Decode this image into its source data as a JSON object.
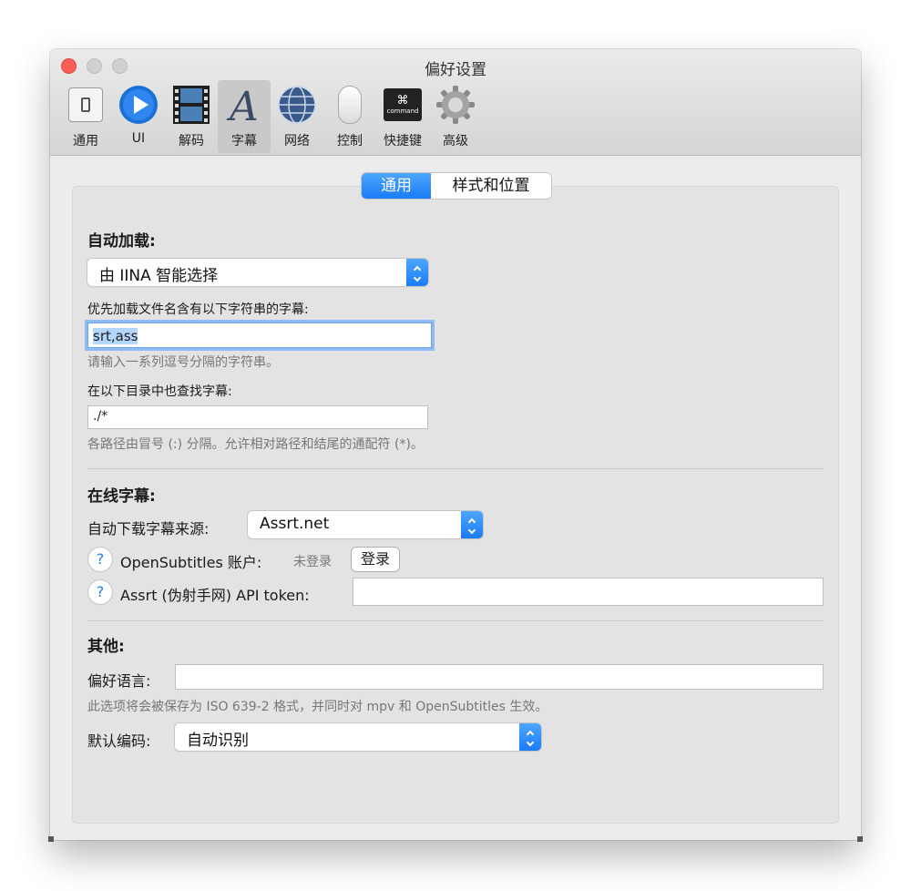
{
  "window": {
    "title": "偏好设置"
  },
  "toolbar": {
    "items": [
      {
        "label": "通用",
        "icon": "general-switch-icon"
      },
      {
        "label": "UI",
        "icon": "play-circle-icon"
      },
      {
        "label": "解码",
        "icon": "film-icon"
      },
      {
        "label": "字幕",
        "icon": "letter-a-icon",
        "selected": true
      },
      {
        "label": "网络",
        "icon": "globe-icon"
      },
      {
        "label": "控制",
        "icon": "mouse-icon"
      },
      {
        "label": "快捷键",
        "icon": "command-key-icon"
      },
      {
        "label": "高级",
        "icon": "gear-icon"
      }
    ],
    "command_key_symbol": "⌘",
    "command_key_text": "command"
  },
  "tabs": {
    "general": "通用",
    "style": "样式和位置"
  },
  "autoload": {
    "heading": "自动加载:",
    "mode_value": "由 IINA 智能选择",
    "priority_label": "优先加载文件名含有以下字符串的字幕:",
    "priority_value": "srt,ass",
    "priority_hint": "请输入一系列逗号分隔的字符串。",
    "search_label": "在以下目录中也查找字幕:",
    "search_value": "./*",
    "search_hint": "各路径由冒号 (:) 分隔。允许相对路径和结尾的通配符 (*)。"
  },
  "online": {
    "heading": "在线字幕:",
    "source_label": "自动下载字幕来源:",
    "source_value": "Assrt.net",
    "help_symbol": "?",
    "opensub_label": "OpenSubtitles 账户:",
    "opensub_status": "未登录",
    "login_button": "登录",
    "assrt_label": "Assrt (伪射手网) API token:",
    "assrt_token_value": ""
  },
  "other": {
    "heading": "其他:",
    "lang_label": "偏好语言:",
    "lang_value": "",
    "lang_hint": "此选项将会被保存为 ISO 639-2 格式，并同时对 mpv 和 OpenSubtitles 生效。",
    "encoding_label": "默认编码:",
    "encoding_value": "自动识别"
  },
  "colors": {
    "accent": "#1a7cf5",
    "close": "#fc5f57"
  }
}
